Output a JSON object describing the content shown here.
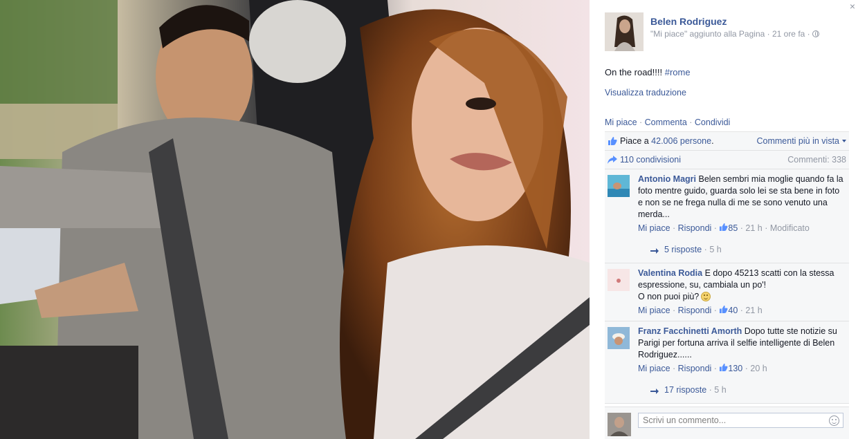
{
  "photo": {
    "alt_desc_icon": "photo"
  },
  "close_label": "×",
  "header": {
    "name": "Belen Rodriguez",
    "meta": "\"Mi piace\" aggiunto alla Pagina · 21 ore fa ·"
  },
  "post": {
    "text": "On the road!!!! ",
    "hashtag": "#rome",
    "see_translation": "Visualizza traduzione"
  },
  "actions": {
    "like": "Mi piace",
    "sep1": " · ",
    "comment": "Commenta",
    "sep2": " · ",
    "share": "Condividi"
  },
  "feedback": {
    "likes_prefix": "Piace a ",
    "likes_link": "42.006 persone",
    "likes_suffix": ".",
    "top_comments": "Commenti più in vista",
    "shares": "110 condivisioni",
    "comment_count": "Commenti: 338"
  },
  "comments": [
    {
      "name": "Antonio Magri",
      "text": " Belen sembri mia moglie quando fa la foto mentre guido, guarda solo lei se sta bene in foto e non se ne frega nulla di me se sono venuto una merda...",
      "like": "Mi piace",
      "reply": "Rispondi",
      "likes": "85",
      "time": "21 h",
      "edited": "Modificato",
      "replies": "5 risposte",
      "replies_time": "5 h"
    },
    {
      "name": "Valentina Rodia",
      "text": " E dopo 45213 scatti con la stessa espressione, su, cambiala un po'!",
      "text2": "O non puoi più?",
      "like": "Mi piace",
      "reply": "Rispondi",
      "likes": "40",
      "time": "21 h"
    },
    {
      "name": "Franz Facchinetti Amorth",
      "text": " Dopo tutte ste notizie su Parigi per fortuna arriva il selfie intelligente di Belen Rodriguez......",
      "like": "Mi piace",
      "reply": "Rispondi",
      "likes": "130",
      "time": "20 h",
      "replies": "17 risposte",
      "replies_time": "5 h"
    }
  ],
  "write_comment": {
    "placeholder": "Scrivi un commento..."
  },
  "colors": {
    "link": "#3b5998",
    "muted": "#9197a3",
    "panel_bg": "#f6f7f8"
  }
}
